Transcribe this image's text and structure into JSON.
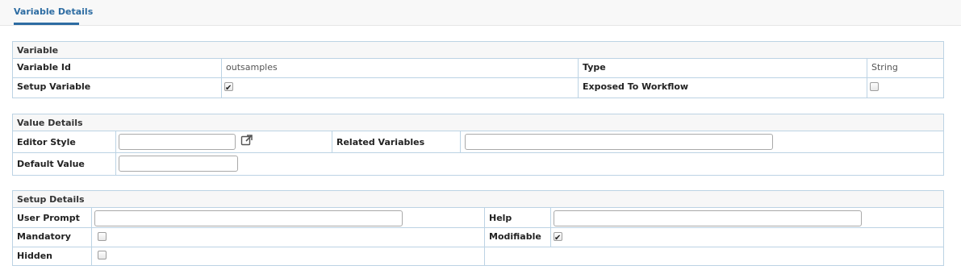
{
  "tabs": {
    "active": "Variable Details"
  },
  "variable": {
    "heading": "Variable",
    "variable_id_label": "Variable Id",
    "variable_id_value": "outsamples",
    "type_label": "Type",
    "type_value": "String",
    "setup_variable_label": "Setup Variable",
    "setup_variable_checked": true,
    "exposed_label": "Exposed To Workflow",
    "exposed_checked": false
  },
  "value_details": {
    "heading": "Value Details",
    "editor_style_label": "Editor Style",
    "editor_style_value": "",
    "related_variables_label": "Related Variables",
    "related_variables_value": "",
    "default_value_label": "Default Value",
    "default_value_value": ""
  },
  "setup_details": {
    "heading": "Setup Details",
    "user_prompt_label": "User Prompt",
    "user_prompt_value": "",
    "help_label": "Help",
    "help_value": "",
    "mandatory_label": "Mandatory",
    "mandatory_checked": false,
    "modifiable_label": "Modifiable",
    "modifiable_checked": true,
    "hidden_label": "Hidden",
    "hidden_checked": false
  },
  "icons": {
    "editor_popup": "external-link-icon"
  },
  "colors": {
    "accent": "#2d6ca2",
    "border": "#bcd3e4",
    "header_bg": "#f7f7f7"
  }
}
